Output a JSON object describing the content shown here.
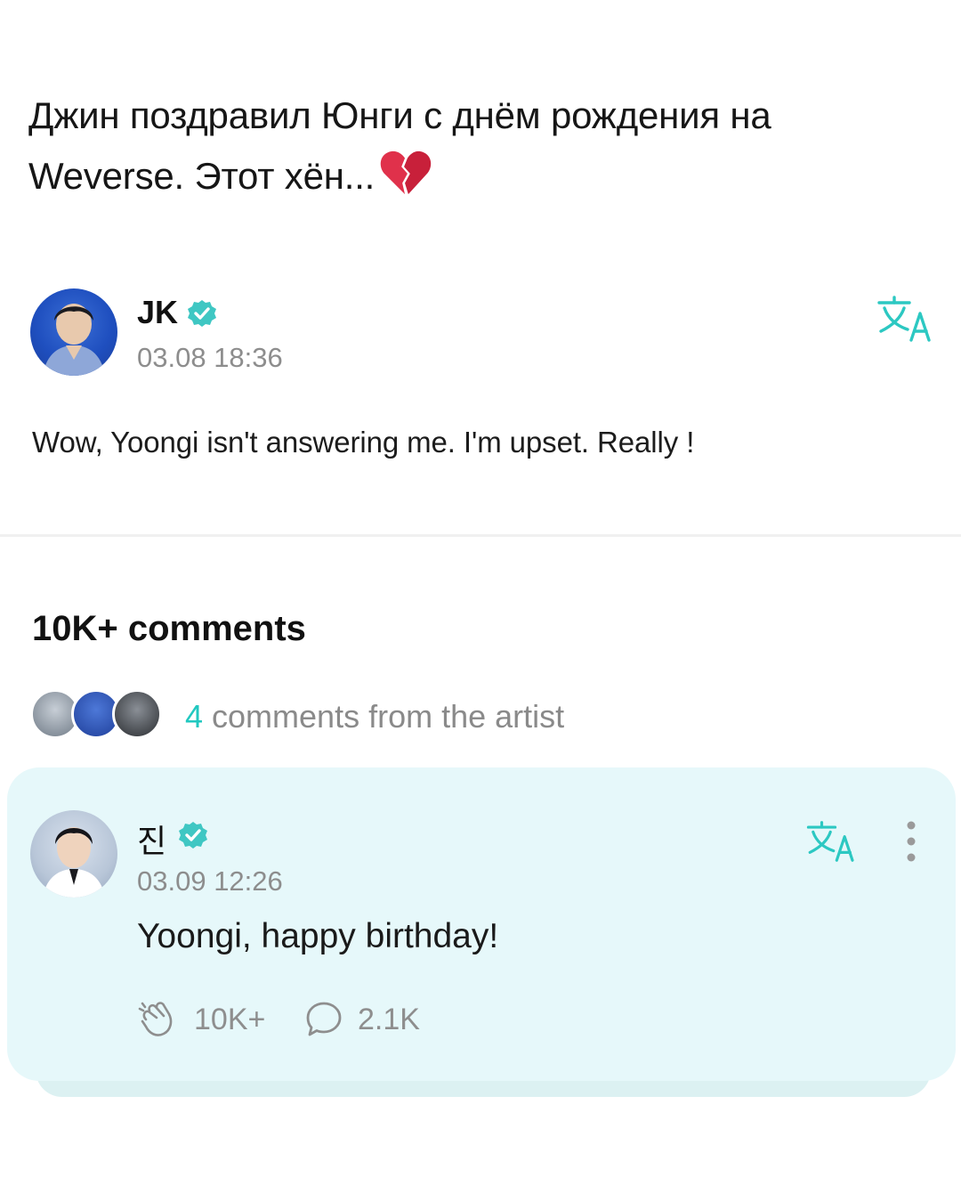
{
  "headline": {
    "text": "Джин поздравил Юнги с днём рождения на Weverse. Этот хён...",
    "emoji": "broken-heart"
  },
  "post": {
    "author": "JK",
    "timestamp": "03.08 18:36",
    "body": "Wow, Yoongi isn't answering me. I'm upset. Really !"
  },
  "comments_section": {
    "count_label": "10K+ comments",
    "artist_count": "4",
    "artist_label": " comments from the artist"
  },
  "comment": {
    "author": "진",
    "timestamp": "03.09 12:26",
    "body": "Yoongi, happy birthday!",
    "likes": "10K+",
    "replies": "2.1K"
  },
  "colors": {
    "accent": "#21c8c0",
    "card_bg": "#e6f8fa",
    "muted_text": "#8d8d8d"
  }
}
